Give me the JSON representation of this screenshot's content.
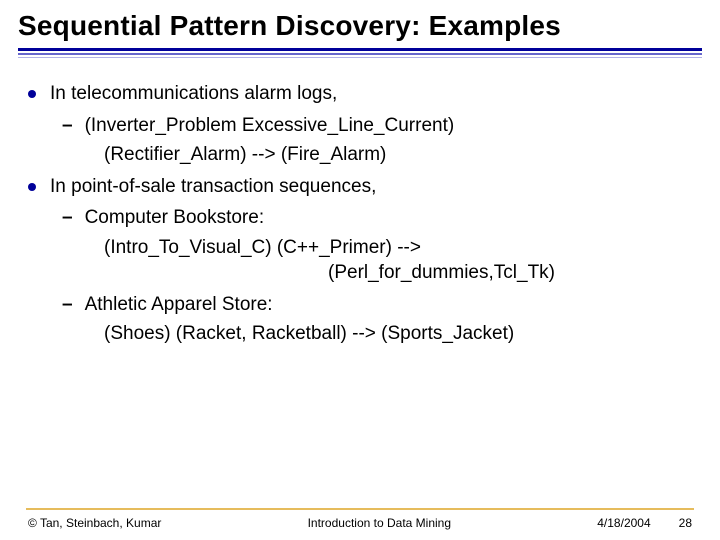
{
  "title": "Sequential Pattern Discovery: Examples",
  "body": {
    "item1": {
      "label": "In telecommunications alarm logs,",
      "sub1": {
        "label": "(Inverter_Problem  Excessive_Line_Current)",
        "cont": "(Rectifier_Alarm) --> (Fire_Alarm)"
      }
    },
    "item2": {
      "label": "In point-of-sale transaction sequences,",
      "sub1": {
        "label": "Computer Bookstore:",
        "line1": "(Intro_To_Visual_C)  (C++_Primer) -->",
        "line2": "(Perl_for_dummies,Tcl_Tk)"
      },
      "sub2": {
        "label": "Athletic Apparel Store:",
        "line1": "(Shoes) (Racket, Racketball) --> (Sports_Jacket)"
      }
    }
  },
  "footer": {
    "copyright": "© Tan, Steinbach, Kumar",
    "center": "Introduction to Data Mining",
    "date": "4/18/2004",
    "page": "28"
  }
}
